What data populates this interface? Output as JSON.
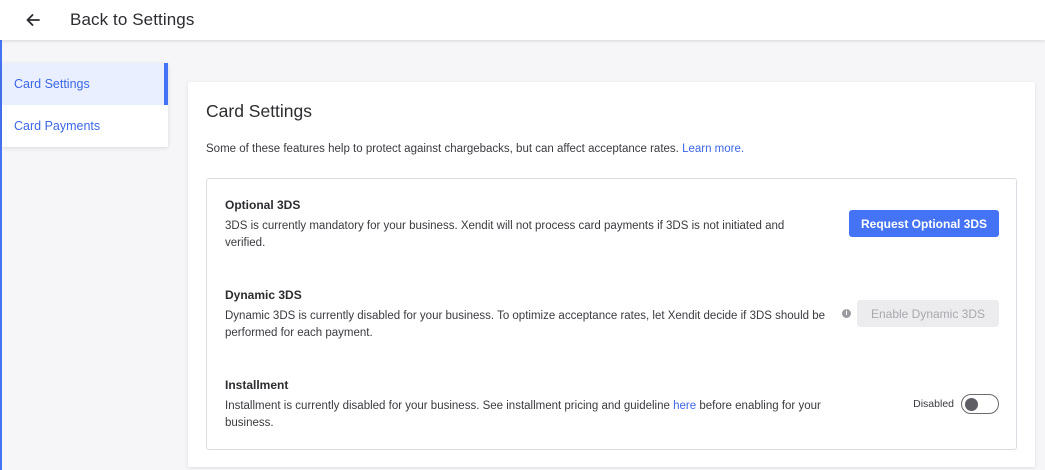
{
  "header": {
    "back_label": "Back to Settings",
    "back_icon": "arrow-left-icon"
  },
  "sidebar": {
    "items": [
      {
        "label": "Card Settings",
        "active": true
      },
      {
        "label": "Card Payments",
        "active": false
      }
    ]
  },
  "panel": {
    "title": "Card Settings",
    "description": "Some of these features help to protect against chargebacks, but can affect acceptance rates.",
    "learn_more": "Learn more."
  },
  "sections": {
    "optional_3ds": {
      "title": "Optional 3DS",
      "description": "3DS is currently mandatory for your business. Xendit will not process card payments if 3DS is not initiated and verified.",
      "button": "Request Optional 3DS"
    },
    "dynamic_3ds": {
      "title": "Dynamic 3DS",
      "description": "Dynamic 3DS is currently disabled for your business. To optimize acceptance rates, let Xendit decide if 3DS should be performed for each payment.",
      "button": "Enable Dynamic 3DS",
      "info_icon": "info-icon"
    },
    "installment": {
      "title": "Installment",
      "description_before": "Installment is currently disabled for your business. See installment pricing and guideline",
      "link": "here",
      "description_after": "before enabling for your business.",
      "toggle_label": "Disabled",
      "toggle_on": false
    }
  },
  "colors": {
    "accent": "#4573f5",
    "link": "#3c67e8",
    "active_bg": "#e9efff"
  }
}
